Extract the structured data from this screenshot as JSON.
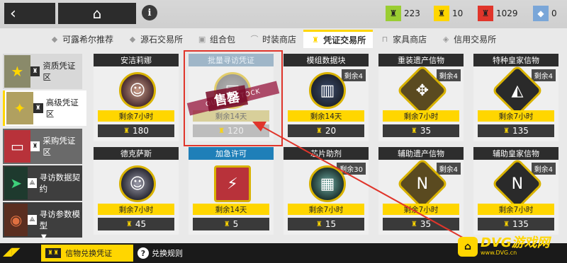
{
  "colors": {
    "accent": "#ffd600",
    "highlight": "#e0352b",
    "dark": "#2d2d2d"
  },
  "header": {
    "back_icon": "chevron-left-icon",
    "home_icon": "home-icon",
    "info_label": "i",
    "currencies": [
      {
        "icon": "credit-icon",
        "value": "223",
        "color": "#9acd32"
      },
      {
        "icon": "voucher-icon",
        "value": "10",
        "color": "#ffd600"
      },
      {
        "icon": "gold-icon",
        "value": "1029",
        "color": "#e0352b"
      },
      {
        "icon": "prime-icon",
        "value": "0",
        "color": "#7aa6d8"
      }
    ]
  },
  "tabs": [
    {
      "label": "可露希尔推荐",
      "active": false
    },
    {
      "label": "源石交易所",
      "active": false
    },
    {
      "label": "组合包",
      "active": false
    },
    {
      "label": "时装商店",
      "active": false
    },
    {
      "label": "凭证交易所",
      "active": true
    },
    {
      "label": "家具商店",
      "active": false
    },
    {
      "label": "信用交易所",
      "active": false
    }
  ],
  "sidebar": {
    "items": [
      {
        "label": "资质凭证区"
      },
      {
        "label": "高级凭证区"
      },
      {
        "label": "采购凭证区"
      },
      {
        "label": "寻访数据契约"
      },
      {
        "label": "寻访参数模型"
      }
    ]
  },
  "cards": [
    {
      "name": "安洁莉娜",
      "remain_badge": "",
      "tag": "剩余7小时",
      "price": "180",
      "icon": "portrait-icon",
      "sold_out": false
    },
    {
      "name": "批量寻访凭证",
      "remain_badge": "",
      "tag": "剩余14天",
      "price": "120",
      "icon": "permit-icon",
      "sold_out": true,
      "stamp": "售罄",
      "ribbon": "OUT OF STOCK"
    },
    {
      "name": "模组数据块",
      "remain_badge": "剩余4",
      "tag": "剩余14天",
      "price": "20",
      "icon": "module-icon",
      "sold_out": false
    },
    {
      "name": "重装遗产信物",
      "remain_badge": "剩余4",
      "tag": "剩余7小时",
      "price": "35",
      "icon": "token-icon",
      "sold_out": false
    },
    {
      "name": "特种皇家信物",
      "remain_badge": "剩余4",
      "tag": "剩余7小时",
      "price": "135",
      "icon": "token-icon",
      "sold_out": false
    },
    {
      "name": "德克萨斯",
      "remain_badge": "",
      "tag": "剩余7小时",
      "price": "45",
      "icon": "portrait-icon",
      "sold_out": false
    },
    {
      "name": "加急许可",
      "remain_badge": "",
      "tag": "剩余14天",
      "price": "5",
      "icon": "expedite-icon",
      "sold_out": false,
      "blue": true
    },
    {
      "name": "芯片助剂",
      "remain_badge": "剩余30",
      "tag": "剩余7小时",
      "price": "15",
      "icon": "chip-icon",
      "sold_out": false
    },
    {
      "name": "辅助遗产信物",
      "remain_badge": "剩余4",
      "tag": "剩余7小时",
      "price": "35",
      "icon": "token-icon",
      "sold_out": false
    },
    {
      "name": "辅助皇家信物",
      "remain_badge": "剩余4",
      "tag": "剩余7小时",
      "price": "135",
      "icon": "token-icon",
      "sold_out": false
    }
  ],
  "bottom": {
    "voucher_label": "信物兑换凭证",
    "rules_label": "兑换规则",
    "rules_icon": "?"
  },
  "watermark": {
    "main": "DVG游戏网",
    "sub": "www.DVG.cn"
  }
}
